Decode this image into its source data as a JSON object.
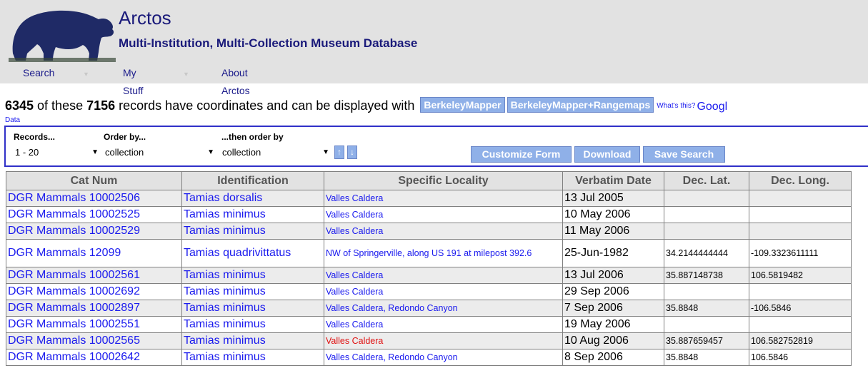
{
  "header": {
    "title": "Arctos",
    "subtitle": "Multi-Institution, Multi-Collection Museum Database",
    "logo_icon": "bear-logo-icon",
    "nav": [
      {
        "label": "Search"
      },
      {
        "label": "My Stuff"
      },
      {
        "label": "About Arctos"
      }
    ]
  },
  "summary": {
    "mapped_count": "6345",
    "text_1": " of these ",
    "total_count": "7156",
    "text_2": " records have coordinates and can be displayed with ",
    "map_buttons": [
      "BerkeleyMapper",
      "BerkeleyMapper+Rangemaps"
    ],
    "whats_this": "What's this?",
    "google_link": "Googl",
    "data_link": "Data"
  },
  "controls": {
    "records_label": "Records...",
    "records_value": "1 - 20",
    "order_label": "Order by...",
    "order_value": "collection",
    "then_label": "...then order by",
    "then_value": "collection",
    "sort_asc": "↑",
    "sort_desc": "↓",
    "buttons": [
      "Customize Form",
      "Download",
      "Save Search"
    ]
  },
  "table": {
    "columns": [
      "Cat Num",
      "Identification",
      "Specific Locality",
      "Verbatim Date",
      "Dec. Lat.",
      "Dec. Long."
    ],
    "rows": [
      {
        "cat": "DGR Mammals 10002506",
        "ident": "Tamias dorsalis",
        "loc": "Valles Caldera",
        "date": "13 Jul 2005",
        "lat": "",
        "long": ""
      },
      {
        "cat": "DGR Mammals 10002525",
        "ident": "Tamias minimus",
        "loc": "Valles Caldera",
        "date": "10 May 2006",
        "lat": "",
        "long": ""
      },
      {
        "cat": "DGR Mammals 10002529",
        "ident": "Tamias minimus",
        "loc": "Valles Caldera",
        "date": "11 May 2006",
        "lat": "",
        "long": ""
      },
      {
        "cat": "DGR Mammals 12099",
        "ident": "Tamias quadrivittatus",
        "loc": "NW of Springerville, along US 191 at milepost 392.6",
        "date": "25-Jun-1982",
        "lat": "34.2144444444",
        "long": "-109.3323611111"
      },
      {
        "cat": "DGR Mammals 10002561",
        "ident": "Tamias minimus",
        "loc": "Valles Caldera",
        "date": "13 Jul 2006",
        "lat": "35.887148738",
        "long": "106.5819482"
      },
      {
        "cat": "DGR Mammals 10002692",
        "ident": "Tamias minimus",
        "loc": "Valles Caldera",
        "date": "29 Sep 2006",
        "lat": "",
        "long": ""
      },
      {
        "cat": "DGR Mammals 10002897",
        "ident": "Tamias minimus",
        "loc": "Valles Caldera, Redondo Canyon",
        "date": "7 Sep 2006",
        "lat": "35.8848",
        "long": "-106.5846"
      },
      {
        "cat": "DGR Mammals 10002551",
        "ident": "Tamias minimus",
        "loc": "Valles Caldera",
        "date": "19 May 2006",
        "lat": "",
        "long": ""
      },
      {
        "cat": "DGR Mammals 10002565",
        "ident": "Tamias minimus",
        "loc": "Valles Caldera",
        "date": "10 Aug 2006",
        "lat": "35.887659457",
        "long": "106.582752819"
      },
      {
        "cat": "DGR Mammals 10002642",
        "ident": "Tamias minimus",
        "loc": "Valles Caldera, Redondo Canyon",
        "date": "8 Sep 2006",
        "lat": "35.8848",
        "long": "106.5846"
      }
    ]
  },
  "colors": {
    "header_bg": "#e2e2e2",
    "link": "#1a1aee",
    "button_bg": "#8fb0e8",
    "highlight_red": "#e01010",
    "controls_border": "#3030c8"
  }
}
